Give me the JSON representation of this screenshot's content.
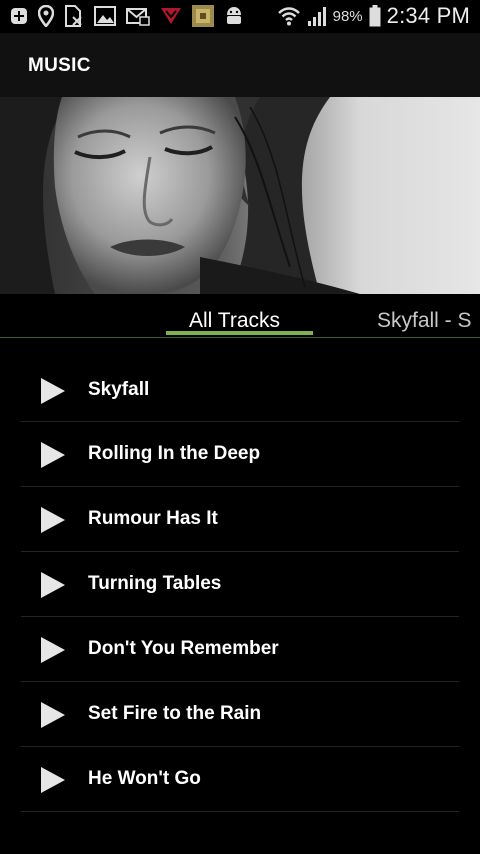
{
  "status_bar": {
    "left_icons": [
      "add-icon",
      "location-icon",
      "no-sim-icon",
      "image-icon",
      "email-icon",
      "shield-icon",
      "app-icon",
      "android-icon"
    ],
    "battery_percent": "98%",
    "time": "2:34 PM"
  },
  "app_bar": {
    "title": "MUSIC"
  },
  "header_image": {
    "description_icon": "artist-photo"
  },
  "tabs": [
    {
      "label": "All Tracks",
      "active": true
    },
    {
      "label": "Skyfall - S",
      "active": false
    }
  ],
  "accent_color": "#7fb24f",
  "tracks": [
    {
      "title": "Skyfall"
    },
    {
      "title": "Rolling In the Deep"
    },
    {
      "title": "Rumour Has It"
    },
    {
      "title": "Turning Tables"
    },
    {
      "title": "Don't You Remember"
    },
    {
      "title": "Set Fire to the Rain"
    },
    {
      "title": "He Won't Go"
    }
  ]
}
